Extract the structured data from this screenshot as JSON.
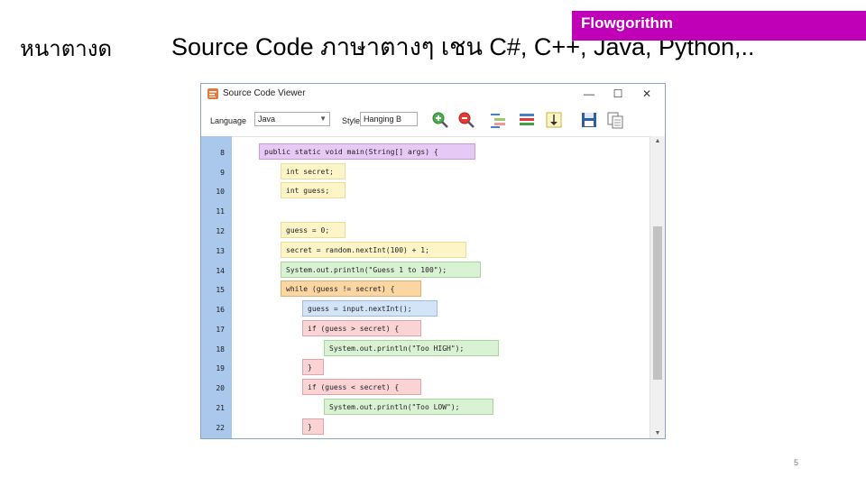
{
  "slide": {
    "left_title": "หนาตางด",
    "title": "Source Code ภาษาตางๆ  เชน   C#, C++, Java, Python,..",
    "brand": "Flowgorithm",
    "page_number": "5"
  },
  "window": {
    "title": "Source Code Viewer",
    "minimize": "—",
    "maximize": "☐",
    "close": "✕"
  },
  "toolbar": {
    "language_label": "Language",
    "language_value": "Java",
    "style_label": "Style",
    "style_value": "Hanging B"
  },
  "colors": {
    "gutter": "#a9c8ec",
    "purple": "#e7c9f5",
    "yellow": "#fdf5c8",
    "green": "#d9f2d3",
    "orange": "#fbd6a3",
    "blue": "#d3e3f8",
    "pink": "#fad4d4",
    "brand": "#c000b6"
  },
  "code_lines": [
    {
      "num": "8",
      "text": "public static void main(String[] args) {",
      "color": "purple"
    },
    {
      "num": "9",
      "text": "int secret;",
      "color": "yellow"
    },
    {
      "num": "10",
      "text": "int guess;",
      "color": "yellow"
    },
    {
      "num": "11",
      "text": "",
      "color": ""
    },
    {
      "num": "12",
      "text": "guess = 0;",
      "color": "yellow"
    },
    {
      "num": "13",
      "text": "secret = random.nextInt(100) + 1;",
      "color": "yellow"
    },
    {
      "num": "14",
      "text": "System.out.println(\"Guess 1 to 100\");",
      "color": "green"
    },
    {
      "num": "15",
      "text": "while (guess != secret) {",
      "color": "orange"
    },
    {
      "num": "16",
      "text": "guess = input.nextInt();",
      "color": "blue"
    },
    {
      "num": "17",
      "text": "if (guess > secret) {",
      "color": "pink"
    },
    {
      "num": "18",
      "text": "System.out.println(\"Too HIGH\");",
      "color": "green"
    },
    {
      "num": "19",
      "text": "}",
      "color": "pink"
    },
    {
      "num": "20",
      "text": "if (guess < secret) {",
      "color": "pink"
    },
    {
      "num": "21",
      "text": "System.out.println(\"Too LOW\");",
      "color": "green"
    },
    {
      "num": "22",
      "text": "}",
      "color": "pink"
    }
  ]
}
